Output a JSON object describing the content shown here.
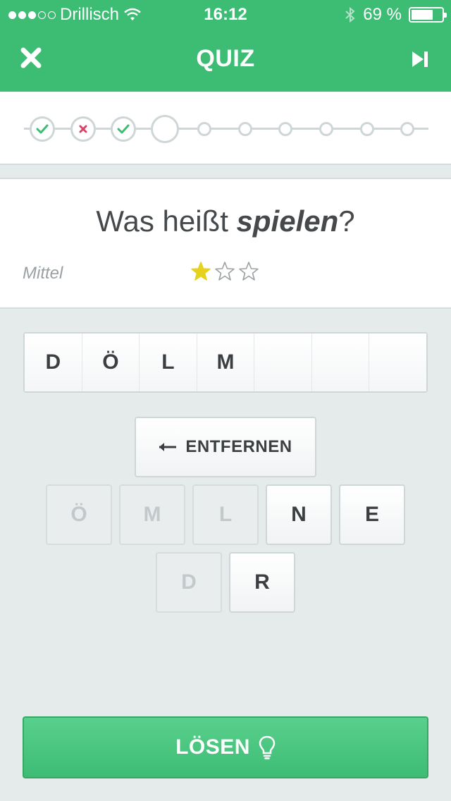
{
  "status": {
    "carrier": "Drillisch",
    "time": "16:12",
    "battery": "69 %",
    "battery_level": 0.69,
    "signal_bars": 3,
    "signal_total": 5
  },
  "nav": {
    "title": "QUIZ",
    "close_icon": "close-icon",
    "skip_icon": "skip-forward-icon"
  },
  "progress": {
    "steps": [
      "correct",
      "wrong",
      "correct",
      "current",
      "pending",
      "pending",
      "pending",
      "pending",
      "pending",
      "pending"
    ]
  },
  "question": {
    "prefix": "Was heißt ",
    "word": "spielen",
    "suffix": "?",
    "difficulty_label": "Mittel",
    "difficulty_stars": 1,
    "max_stars": 3
  },
  "answer": {
    "slots": [
      "D",
      "Ö",
      "L",
      "M",
      "",
      "",
      ""
    ]
  },
  "keyboard": {
    "remove_label": "ENTFERNEN",
    "row1": [
      {
        "letter": "Ö",
        "used": true
      },
      {
        "letter": "M",
        "used": true
      },
      {
        "letter": "L",
        "used": true
      },
      {
        "letter": "N",
        "used": false
      },
      {
        "letter": "E",
        "used": false
      }
    ],
    "row2": [
      {
        "letter": "D",
        "used": true
      },
      {
        "letter": "R",
        "used": false
      }
    ]
  },
  "solve": {
    "label": "LÖSEN",
    "icon": "lightbulb-icon"
  },
  "colors": {
    "brand_green": "#3dbc74",
    "correct": "#3dbc74",
    "wrong": "#d8436a",
    "star": "#e6d21c"
  }
}
